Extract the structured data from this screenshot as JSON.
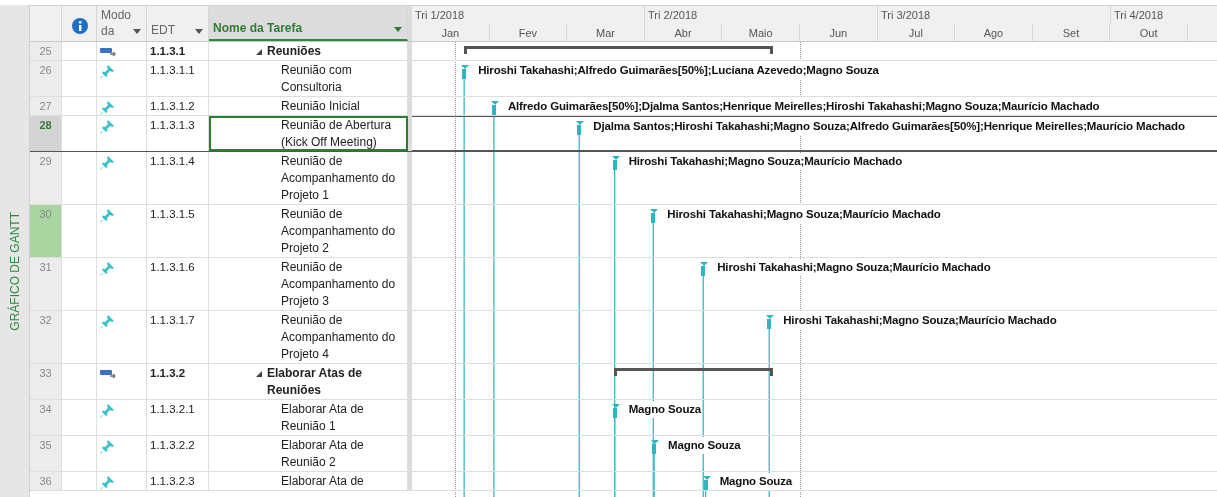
{
  "view_label": "GRÁFICO DE GANTT",
  "columns": [
    {
      "kind": "info",
      "selected": false
    },
    {
      "kind": "mode",
      "label": "Modo da",
      "selected": false
    },
    {
      "kind": "edt",
      "label": "EDT",
      "selected": false
    },
    {
      "kind": "name",
      "label": "Nome da Tarefa",
      "selected": true
    }
  ],
  "timeline": {
    "quarters": [
      {
        "label": "Tri 1/2018"
      },
      {
        "label": "Tri 2/2018"
      },
      {
        "label": "Tri 3/2018"
      },
      {
        "label": "Tri 4/2018"
      }
    ],
    "months": [
      {
        "label": "Jan"
      },
      {
        "label": "Fev"
      },
      {
        "label": "Mar"
      },
      {
        "label": "Abr"
      },
      {
        "label": "Maio"
      },
      {
        "label": "Jun"
      },
      {
        "label": "Jul"
      },
      {
        "label": "Ago"
      },
      {
        "label": "Set"
      },
      {
        "label": "Out"
      }
    ]
  },
  "rows": [
    {
      "id": "25",
      "kind": "auto",
      "edt": "1.1.3.1",
      "name": "Reuniões",
      "summary": {
        "expanded": true
      },
      "selected": false,
      "highlighted": false,
      "bar": {
        "kind": "summary"
      }
    },
    {
      "id": "26",
      "kind": "manual",
      "edt": "1.1.3.1.1",
      "name": "Reunião com Consultoria",
      "selected": false,
      "highlighted": false,
      "bar": {
        "kind": "task",
        "resources": "Hiroshi Takahashi;Alfredo Guimarães[50%];Luciana Azevedo;Magno Souza"
      }
    },
    {
      "id": "27",
      "kind": "manual",
      "edt": "1.1.3.1.2",
      "name": "Reunião Inicial",
      "selected": false,
      "highlighted": false,
      "bar": {
        "kind": "task",
        "resources": "Alfredo Guimarães[50%];Djalma Santos;Henrique Meirelles;Hiroshi Takahashi;Magno Souza;Maurício Machado"
      }
    },
    {
      "id": "28",
      "kind": "manual",
      "edt": "1.1.3.1.3",
      "name": "Reunião de Abertura (Kick Off Meeting)",
      "selected": true,
      "highlighted": false,
      "bar": {
        "kind": "task",
        "resources": "Djalma Santos;Hiroshi Takahashi;Magno Souza;Alfredo Guimarães[50%];Henrique Meirelles;Maurício Machado"
      }
    },
    {
      "id": "29",
      "kind": "manual",
      "edt": "1.1.3.1.4",
      "name": "Reunião de Acompanhamento do Projeto 1",
      "selected": false,
      "highlighted": false,
      "bar": {
        "kind": "task",
        "resources": "Hiroshi Takahashi;Magno Souza;Maurício Machado"
      }
    },
    {
      "id": "30",
      "kind": "manual",
      "edt": "1.1.3.1.5",
      "name": "Reunião de Acompanhamento do Projeto 2",
      "selected": false,
      "highlighted": true,
      "bar": {
        "kind": "task",
        "resources": "Hiroshi Takahashi;Magno Souza;Maurício Machado"
      }
    },
    {
      "id": "31",
      "kind": "manual",
      "edt": "1.1.3.1.6",
      "name": "Reunião de Acompanhamento do Projeto 3",
      "selected": false,
      "highlighted": false,
      "bar": {
        "kind": "task",
        "resources": "Hiroshi Takahashi;Magno Souza;Maurício Machado"
      }
    },
    {
      "id": "32",
      "kind": "manual",
      "edt": "1.1.3.1.7",
      "name": "Reunião de Acompanhamento do Projeto 4",
      "selected": false,
      "highlighted": false,
      "bar": {
        "kind": "task",
        "resources": "Hiroshi Takahashi;Magno Souza;Maurício Machado"
      }
    },
    {
      "id": "33",
      "kind": "auto",
      "edt": "1.1.3.2",
      "name": "Elaborar Atas de Reuniões",
      "summary": {
        "expanded": true
      },
      "selected": false,
      "highlighted": false,
      "bar": {
        "kind": "summary"
      }
    },
    {
      "id": "34",
      "kind": "manual",
      "edt": "1.1.3.2.1",
      "name": "Elaborar Ata de Reunião 1",
      "selected": false,
      "highlighted": false,
      "bar": {
        "kind": "task",
        "resources": "Magno Souza"
      }
    },
    {
      "id": "35",
      "kind": "manual",
      "edt": "1.1.3.2.2",
      "name": "Elaborar Ata de Reunião 2",
      "selected": false,
      "highlighted": false,
      "bar": {
        "kind": "task",
        "resources": "Magno Souza"
      }
    },
    {
      "id": "36",
      "kind": "manual",
      "edt": "1.1.3.2.3",
      "name": "Elaborar Ata de",
      "selected": false,
      "highlighted": false,
      "bar": {
        "kind": "task",
        "resources": "Magno Souza"
      }
    }
  ]
}
